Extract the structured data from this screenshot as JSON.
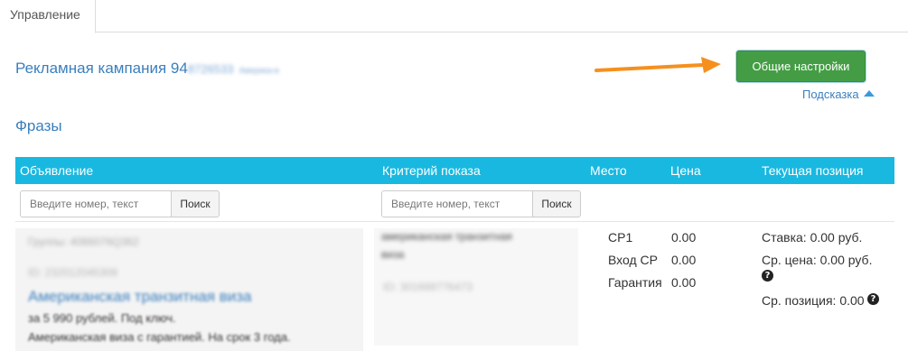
{
  "tabs": [
    {
      "label": "Управление",
      "active": true
    }
  ],
  "campaign": {
    "title_prefix": "Рекламная кампания 94",
    "title_blurred": "8726533",
    "title_blurred_small": "Америка-в"
  },
  "buttons": {
    "general_settings": "Общие настройки"
  },
  "hint": {
    "label": "Подсказка"
  },
  "section": {
    "title": "Фразы"
  },
  "table": {
    "columns": [
      "Объявление",
      "Критерий показа",
      "Место",
      "Цена",
      "Текущая позиция"
    ],
    "filters": {
      "ad_search": {
        "placeholder": "Введите номер, текст",
        "button": "Поиск"
      },
      "criterion_search": {
        "placeholder": "Введите номер, текст",
        "button": "Поиск"
      }
    },
    "rows": [
      {
        "ad": {
          "group": "Группы: 4066076Q362",
          "id": "ID: 232012045309",
          "title": "Американская транзитная виза",
          "line1": "за 5 990 рублей. Под ключ.",
          "line2": "Американская виза с гарантией. На срок 3 года."
        },
        "criterion": {
          "text_line1": "американская транзитная",
          "text_line2": "виза",
          "id": "ID: 301699776473"
        },
        "places": [
          {
            "name": "СР1",
            "price": "0.00"
          },
          {
            "name": "Вход СР",
            "price": "0.00"
          },
          {
            "name": "Гарантия",
            "price": "0.00"
          }
        ],
        "position": {
          "bid": "Ставка: 0.00 руб.",
          "avg_price": "Ср. цена: 0.00 руб.",
          "avg_position": "Ср. позиция: 0.00"
        }
      }
    ]
  },
  "colors": {
    "accent_blue": "#3a7fbd",
    "table_header": "#19b8e0",
    "button_green": "#449d44",
    "arrow_orange": "#f5901e"
  }
}
